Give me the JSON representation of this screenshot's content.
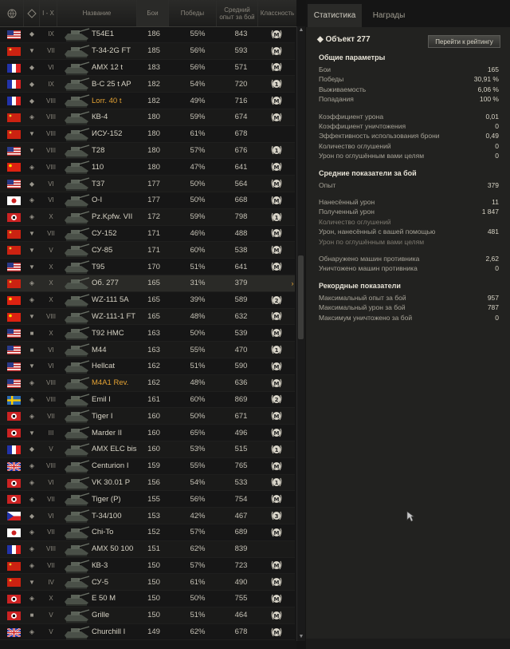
{
  "header": {
    "col_tier": "I - X",
    "col_name": "Название",
    "col_battles": "Бои",
    "col_wins": "Победы",
    "col_xp": "Средний опыт за бой",
    "col_class": "Классность"
  },
  "tabs": [
    "Статистика",
    "Награды"
  ],
  "colors": {
    "gold": "#e3a234"
  },
  "rows": [
    {
      "nation": "usa",
      "type": "◆",
      "tier": "IX",
      "name": "T54E1",
      "battles": "186",
      "wins": "55%",
      "xp": "843",
      "badge": "M",
      "gold": false
    },
    {
      "nation": "ussr",
      "type": "▼",
      "tier": "VII",
      "name": "T-34-2G FT",
      "battles": "185",
      "wins": "56%",
      "xp": "593",
      "badge": "M",
      "gold": false
    },
    {
      "nation": "france",
      "type": "◆",
      "tier": "VI",
      "name": "AMX 12 t",
      "battles": "183",
      "wins": "56%",
      "xp": "571",
      "badge": "M",
      "gold": false
    },
    {
      "nation": "france",
      "type": "◆",
      "tier": "IX",
      "name": "B-C 25 t AP",
      "battles": "182",
      "wins": "54%",
      "xp": "720",
      "badge": "1",
      "gold": false
    },
    {
      "nation": "france",
      "type": "◆",
      "tier": "VIII",
      "name": "Lorr. 40 t",
      "battles": "182",
      "wins": "49%",
      "xp": "716",
      "badge": "M",
      "gold": true
    },
    {
      "nation": "ussr",
      "type": "◈",
      "tier": "VIII",
      "name": "КВ-4",
      "battles": "180",
      "wins": "59%",
      "xp": "674",
      "badge": "M",
      "gold": false
    },
    {
      "nation": "ussr",
      "type": "▼",
      "tier": "VIII",
      "name": "ИСУ-152",
      "battles": "180",
      "wins": "61%",
      "xp": "678",
      "badge": "",
      "gold": false
    },
    {
      "nation": "usa",
      "type": "▼",
      "tier": "VIII",
      "name": "T28",
      "battles": "180",
      "wins": "57%",
      "xp": "676",
      "badge": "1",
      "gold": false
    },
    {
      "nation": "china",
      "type": "◈",
      "tier": "VIII",
      "name": "110",
      "battles": "180",
      "wins": "47%",
      "xp": "641",
      "badge": "M",
      "gold": false
    },
    {
      "nation": "usa",
      "type": "◆",
      "tier": "VI",
      "name": "T37",
      "battles": "177",
      "wins": "50%",
      "xp": "564",
      "badge": "M",
      "gold": false
    },
    {
      "nation": "japan",
      "type": "◈",
      "tier": "VI",
      "name": "O-I",
      "battles": "177",
      "wins": "50%",
      "xp": "668",
      "badge": "M",
      "gold": false
    },
    {
      "nation": "germany",
      "type": "◈",
      "tier": "X",
      "name": "Pz.Kpfw. VII",
      "battles": "172",
      "wins": "59%",
      "xp": "798",
      "badge": "1",
      "gold": false
    },
    {
      "nation": "ussr",
      "type": "▼",
      "tier": "VII",
      "name": "СУ-152",
      "battles": "171",
      "wins": "46%",
      "xp": "488",
      "badge": "M",
      "gold": false
    },
    {
      "nation": "ussr",
      "type": "▼",
      "tier": "V",
      "name": "СУ-85",
      "battles": "171",
      "wins": "60%",
      "xp": "538",
      "badge": "M",
      "gold": false
    },
    {
      "nation": "usa",
      "type": "▼",
      "tier": "X",
      "name": "T95",
      "battles": "170",
      "wins": "51%",
      "xp": "641",
      "badge": "M",
      "gold": false
    },
    {
      "nation": "ussr",
      "type": "◈",
      "tier": "X",
      "name": "Об. 277",
      "battles": "165",
      "wins": "31%",
      "xp": "379",
      "badge": "",
      "gold": false,
      "selected": true
    },
    {
      "nation": "china",
      "type": "◈",
      "tier": "X",
      "name": "WZ-111 5A",
      "battles": "165",
      "wins": "39%",
      "xp": "589",
      "badge": "2",
      "gold": false
    },
    {
      "nation": "china",
      "type": "▼",
      "tier": "VIII",
      "name": "WZ-111-1 FT",
      "battles": "165",
      "wins": "48%",
      "xp": "632",
      "badge": "M",
      "gold": false
    },
    {
      "nation": "usa",
      "type": "■",
      "tier": "X",
      "name": "T92 HMC",
      "battles": "163",
      "wins": "50%",
      "xp": "539",
      "badge": "M",
      "gold": false
    },
    {
      "nation": "usa",
      "type": "■",
      "tier": "VI",
      "name": "M44",
      "battles": "163",
      "wins": "55%",
      "xp": "470",
      "badge": "1",
      "gold": false
    },
    {
      "nation": "usa",
      "type": "▼",
      "tier": "VI",
      "name": "Hellcat",
      "battles": "162",
      "wins": "51%",
      "xp": "590",
      "badge": "M",
      "gold": false
    },
    {
      "nation": "usa",
      "type": "◈",
      "tier": "VIII",
      "name": "M4A1 Rev.",
      "battles": "162",
      "wins": "48%",
      "xp": "636",
      "badge": "M",
      "gold": true
    },
    {
      "nation": "sweden",
      "type": "◈",
      "tier": "VIII",
      "name": "Emil I",
      "battles": "161",
      "wins": "60%",
      "xp": "869",
      "badge": "2",
      "gold": false
    },
    {
      "nation": "germany",
      "type": "◈",
      "tier": "VII",
      "name": "Tiger I",
      "battles": "160",
      "wins": "50%",
      "xp": "671",
      "badge": "M",
      "gold": false
    },
    {
      "nation": "germany",
      "type": "▼",
      "tier": "III",
      "name": "Marder II",
      "battles": "160",
      "wins": "65%",
      "xp": "496",
      "badge": "M",
      "gold": false
    },
    {
      "nation": "france",
      "type": "◆",
      "tier": "V",
      "name": "AMX ELC bis",
      "battles": "160",
      "wins": "53%",
      "xp": "515",
      "badge": "1",
      "gold": false
    },
    {
      "nation": "uk",
      "type": "◈",
      "tier": "VIII",
      "name": "Centurion I",
      "battles": "159",
      "wins": "55%",
      "xp": "765",
      "badge": "M",
      "gold": false
    },
    {
      "nation": "germany",
      "type": "◈",
      "tier": "VI",
      "name": "VK 30.01 P",
      "battles": "156",
      "wins": "54%",
      "xp": "533",
      "badge": "1",
      "gold": false
    },
    {
      "nation": "germany",
      "type": "◈",
      "tier": "VII",
      "name": "Tiger (P)",
      "battles": "155",
      "wins": "56%",
      "xp": "754",
      "badge": "M",
      "gold": false
    },
    {
      "nation": "czech",
      "type": "◆",
      "tier": "VI",
      "name": "T-34/100",
      "battles": "153",
      "wins": "42%",
      "xp": "467",
      "badge": "3",
      "gold": false
    },
    {
      "nation": "japan",
      "type": "◈",
      "tier": "VII",
      "name": "Chi-To",
      "battles": "152",
      "wins": "57%",
      "xp": "689",
      "badge": "M",
      "gold": false
    },
    {
      "nation": "france",
      "type": "◈",
      "tier": "VIII",
      "name": "AMX 50 100",
      "battles": "151",
      "wins": "62%",
      "xp": "839",
      "badge": "",
      "gold": false
    },
    {
      "nation": "ussr",
      "type": "◈",
      "tier": "VII",
      "name": "КВ-3",
      "battles": "150",
      "wins": "57%",
      "xp": "723",
      "badge": "M",
      "gold": false
    },
    {
      "nation": "ussr",
      "type": "▼",
      "tier": "IV",
      "name": "СУ-5",
      "battles": "150",
      "wins": "61%",
      "xp": "490",
      "badge": "M",
      "gold": false
    },
    {
      "nation": "germany",
      "type": "◈",
      "tier": "X",
      "name": "E 50 M",
      "battles": "150",
      "wins": "50%",
      "xp": "755",
      "badge": "M",
      "gold": false
    },
    {
      "nation": "germany",
      "type": "■",
      "tier": "V",
      "name": "Grille",
      "battles": "150",
      "wins": "51%",
      "xp": "464",
      "badge": "M",
      "gold": false
    },
    {
      "nation": "uk",
      "type": "◈",
      "tier": "V",
      "name": "Churchill I",
      "battles": "149",
      "wins": "62%",
      "xp": "678",
      "badge": "M",
      "gold": false
    }
  ],
  "panel": {
    "title": "Объект 277",
    "rating_button": "Перейти к рейтингу",
    "sections": [
      {
        "heading": "Общие параметры",
        "items": [
          {
            "label": "Бои",
            "value": "165"
          },
          {
            "label": "Победы",
            "value": "30,91 %"
          },
          {
            "label": "Выживаемость",
            "value": "6,06 %"
          },
          {
            "label": "Попадания",
            "value": "100 %"
          },
          {
            "gap": true
          },
          {
            "label": "Коэффициент урона",
            "value": "0,01"
          },
          {
            "label": "Коэффициент уничтожения",
            "value": "0"
          },
          {
            "label": "Эффективность использования брони",
            "value": "0,49"
          },
          {
            "label": "Количество оглушений",
            "value": "0"
          },
          {
            "label": "Урон по оглушённым вами целям",
            "value": "0"
          }
        ]
      },
      {
        "heading": "Средние показатели за бой",
        "items": [
          {
            "label": "Опыт",
            "value": "379"
          },
          {
            "gap": true
          },
          {
            "label": "Нанесённый урон",
            "value": "11"
          },
          {
            "label": "Полученный урон",
            "value": "1 847"
          },
          {
            "label": "Количество оглушений",
            "value": "",
            "dim": true
          },
          {
            "label": "Урон, нанесённый с вашей помощью",
            "value": "481"
          },
          {
            "label": "Урон по оглушённым вами целям",
            "value": "",
            "dim": true
          },
          {
            "gap": true
          },
          {
            "label": "Обнаружено машин противника",
            "value": "2,62"
          },
          {
            "label": "Уничтожено машин противника",
            "value": "0"
          }
        ]
      },
      {
        "heading": "Рекордные показатели",
        "items": [
          {
            "label": "Максимальный опыт за бой",
            "value": "957"
          },
          {
            "label": "Максимальный урон за бой",
            "value": "787"
          },
          {
            "label": "Максимум уничтожено за бой",
            "value": "0"
          }
        ]
      }
    ]
  }
}
